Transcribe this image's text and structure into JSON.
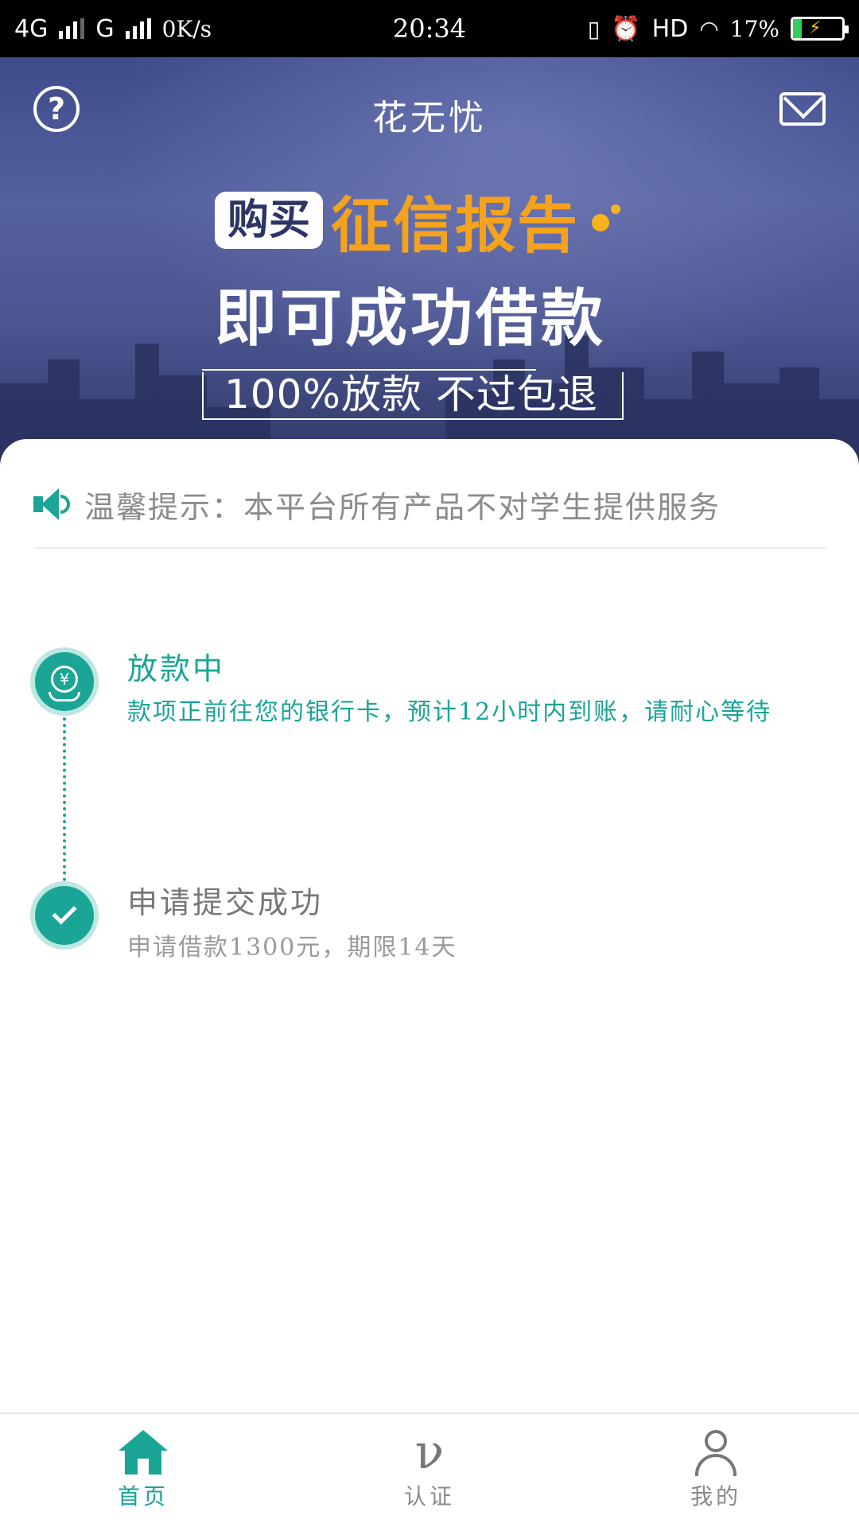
{
  "status_bar": {
    "network1": "4G",
    "network2": "G",
    "speed": "0K/s",
    "time": "20:34",
    "hd": "HD",
    "battery_percent": "17%",
    "battery_level": 0.17
  },
  "header": {
    "title": "花无忧",
    "help_icon": "question-circle-icon",
    "mail_icon": "mail-icon"
  },
  "banner": {
    "badge": "购买",
    "highlight": "征信报告",
    "line2": "即可成功借款",
    "line3": "100%放款   不过包退",
    "highlight_color": "#f5a21c"
  },
  "notice": {
    "icon": "speaker-icon",
    "text": "温馨提示：本平台所有产品不对学生提供服务"
  },
  "timeline": [
    {
      "title": "放款中",
      "desc": "款项正前往您的银行卡，预计12小时内到账，请耐心等待",
      "icon": "money-hand-icon"
    },
    {
      "title": "申请提交成功",
      "desc": "申请借款1300元，期限14天",
      "icon": "check-icon"
    }
  ],
  "bottom_nav": [
    {
      "label": "首页",
      "icon": "home-icon",
      "active": true
    },
    {
      "label": "认证",
      "icon": "verify-icon",
      "active": false
    },
    {
      "label": "我的",
      "icon": "person-icon",
      "active": false
    }
  ],
  "colors": {
    "accent": "#1aa596",
    "banner_bg": "#4a5590"
  }
}
